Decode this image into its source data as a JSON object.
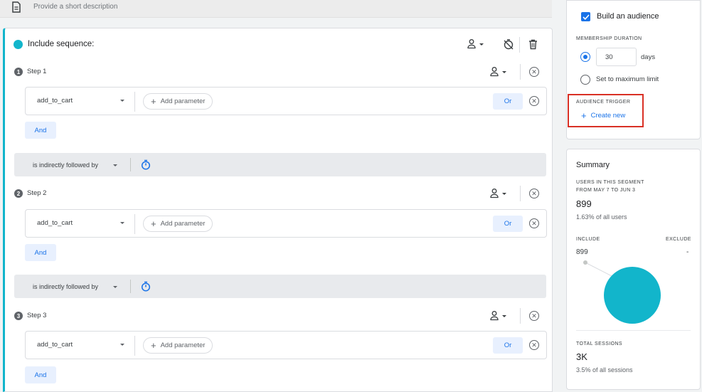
{
  "description": {
    "placeholder": "Provide a short description"
  },
  "sequence": {
    "title": "Include sequence:",
    "steps": [
      {
        "number": "1",
        "label": "Step 1",
        "event": "add_to_cart",
        "add_param": "Add parameter",
        "or_label": "Or",
        "and_label": "And"
      },
      {
        "number": "2",
        "label": "Step 2",
        "event": "add_to_cart",
        "add_param": "Add parameter",
        "or_label": "Or",
        "and_label": "And"
      },
      {
        "number": "3",
        "label": "Step 3",
        "event": "add_to_cart",
        "add_param": "Add parameter",
        "or_label": "Or",
        "and_label": "And"
      }
    ],
    "connectors": [
      {
        "label": "is indirectly followed by"
      },
      {
        "label": "is indirectly followed by"
      }
    ]
  },
  "audience": {
    "build_label": "Build an audience",
    "build_checked": true,
    "membership_heading": "MEMBERSHIP DURATION",
    "days_value": "30",
    "days_unit": "days",
    "max_limit_label": "Set to maximum limit",
    "trigger_heading": "AUDIENCE TRIGGER",
    "create_new_label": "Create new",
    "highlight_color": "#d93025"
  },
  "summary": {
    "title": "Summary",
    "users_heading_line1": "USERS IN THIS SEGMENT",
    "users_heading_line2": "FROM MAY 7 TO JUN 3",
    "users_count": "899",
    "users_pct": "1.63% of all users",
    "include_label": "INCLUDE",
    "exclude_label": "EXCLUDE",
    "include_value": "899",
    "exclude_value": "-",
    "sessions_heading": "TOTAL SESSIONS",
    "sessions_count": "3K",
    "sessions_pct": "3.5% of all sessions"
  },
  "colors": {
    "accent": "#1a73e8",
    "teal": "#12b5cb",
    "chip_bg": "#e8f0fe"
  }
}
